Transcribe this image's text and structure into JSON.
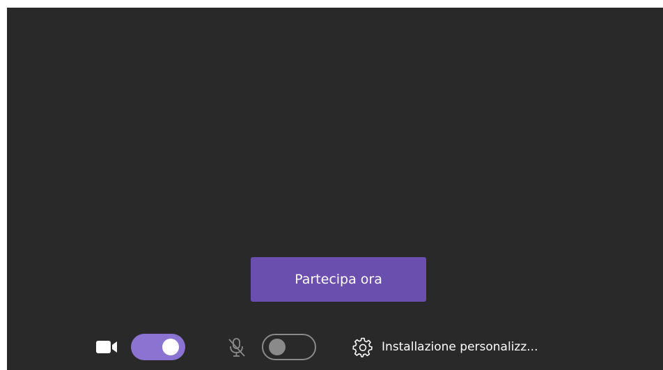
{
  "join": {
    "label": "Partecipa ora"
  },
  "camera": {
    "icon": "video-camera-icon",
    "enabled": true
  },
  "microphone": {
    "icon": "microphone-off-icon",
    "enabled": false
  },
  "settings": {
    "icon": "gear-icon",
    "label": "Installazione personalizz..."
  },
  "colors": {
    "background": "#292929",
    "accent": "#6b4fae",
    "toggle_on": "#8a73d1",
    "toggle_off": "#8a8a8a"
  }
}
